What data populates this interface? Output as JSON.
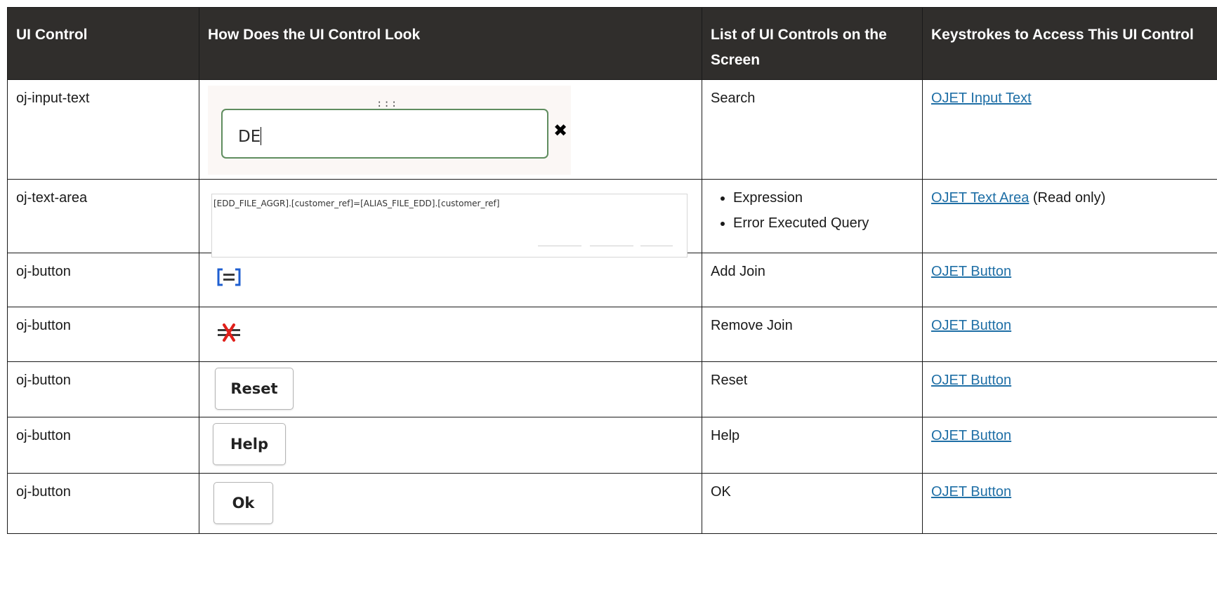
{
  "headers": {
    "ui_control": "UI Control",
    "look": "How Does the UI Control Look",
    "list": "List of UI Controls on the Screen",
    "keystrokes": "Keystrokes to Access This UI Control"
  },
  "rows": [
    {
      "control": "oj-input-text",
      "list_items": [
        "Search"
      ],
      "link": "OJET Input Text",
      "link_suffix": "",
      "mock": {
        "grip": ":::",
        "value": "DE",
        "clear_icon": "close-icon"
      }
    },
    {
      "control": "oj-text-area",
      "list_items": [
        "Expression",
        "Error Executed Query"
      ],
      "link": "OJET Text Area",
      "link_suffix": " (Read only)",
      "mock": {
        "value": "[EDD_FILE_AGGR].[customer_ref]=[ALIAS_FILE_EDD].[customer_ref]"
      }
    },
    {
      "control": "oj-button",
      "list_items": [
        "Add Join"
      ],
      "link": "OJET Button",
      "link_suffix": "",
      "mock": {
        "icon": "add-join-icon",
        "icon_color": "#1f5fd1"
      }
    },
    {
      "control": "oj-button",
      "list_items": [
        "Remove Join"
      ],
      "link": "OJET Button",
      "link_suffix": "",
      "mock": {
        "icon": "remove-join-icon",
        "icon_color": "#e0201b"
      }
    },
    {
      "control": "oj-button",
      "list_items": [
        "Reset"
      ],
      "link": "OJET Button",
      "link_suffix": "",
      "mock": {
        "button_label": "Reset"
      }
    },
    {
      "control": "oj-button",
      "list_items": [
        "Help"
      ],
      "link": "OJET Button",
      "link_suffix": "",
      "mock": {
        "button_label": "Help"
      }
    },
    {
      "control": "oj-button",
      "list_items": [
        "OK"
      ],
      "link": "OJET Button",
      "link_suffix": "",
      "mock": {
        "button_label": "Ok"
      }
    }
  ],
  "colors": {
    "header_bg": "#302e2c",
    "link": "#1f6fa6",
    "input_border": "#5f8d5f"
  }
}
